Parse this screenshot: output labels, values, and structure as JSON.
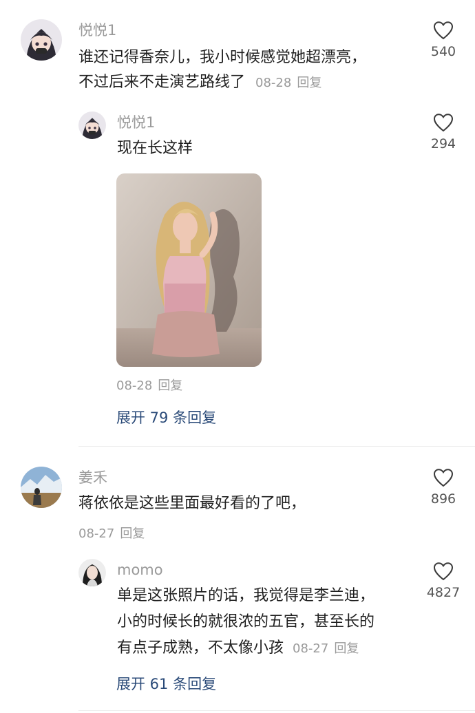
{
  "comments": [
    {
      "username": "悦悦1",
      "text_lines": [
        "谁还记得香奈儿，我小时候感觉她超漂亮，",
        "不过后来不走演艺路线了"
      ],
      "date": "08-28",
      "reply_label": "回复",
      "likes": "540",
      "reply": {
        "username": "悦悦1",
        "text": "现在长这样",
        "date": "08-28",
        "reply_label": "回复",
        "likes": "294"
      },
      "expand_label": "展开 79 条回复"
    },
    {
      "username": "姜禾",
      "text": "蒋依依是这些里面最好看的了吧，",
      "date": "08-27",
      "reply_label": "回复",
      "likes": "896",
      "reply": {
        "username": "momo",
        "text_lines": [
          "单是这张照片的话，我觉得是李兰迪，",
          "小的时候长的就很浓的五官，甚至长的",
          "有点子成熟，不太像小孩"
        ],
        "date": "08-27",
        "reply_label": "回复",
        "likes": "4827"
      },
      "expand_label": "展开 61 条回复"
    }
  ],
  "icons": {
    "like": "heart-outline-icon"
  },
  "colors": {
    "username": "#9a9a9a",
    "expand_link": "#2a4a78"
  }
}
